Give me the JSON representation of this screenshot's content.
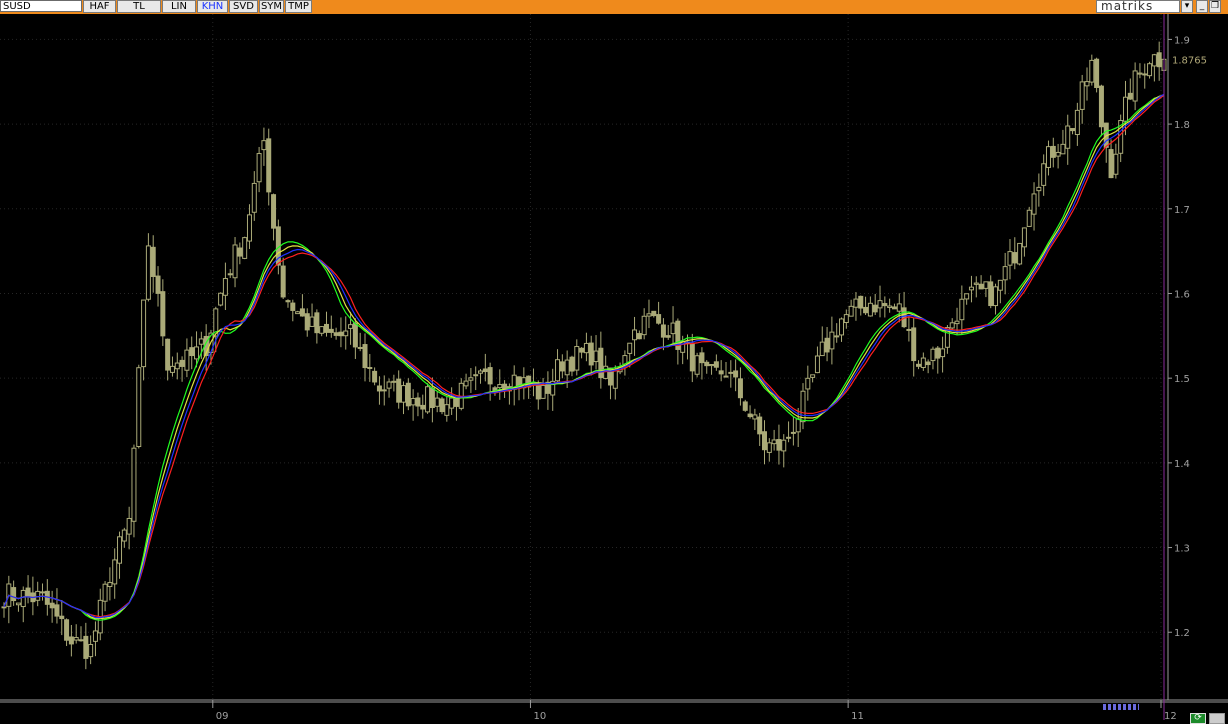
{
  "toolbar": {
    "symbol": "SUSD",
    "buttons": [
      "HAF",
      "TL",
      "LIN",
      "KHN",
      "SVD",
      "SYM",
      "TMP"
    ],
    "active_button": "KHN",
    "brand": "matriks",
    "dropdown_icon": "chevron-down-icon",
    "window_buttons": [
      "minimize-icon",
      "restore-icon"
    ]
  },
  "colors": {
    "background": "#000000",
    "toolbar": "#ef8a1c",
    "candle": "#aaaa78",
    "axis_text": "#a0a0a0",
    "last_price": "#b0a878",
    "ma_blue": "#2030ff",
    "ma_red": "#ff2020",
    "ma_green": "#20ff20",
    "ma_yellow": "#e0e040",
    "cursor_line": "#8a2a9a"
  },
  "chart_data": {
    "type": "candlestick",
    "ylim": [
      1.12,
      1.93
    ],
    "y_ticks": [
      "1.2",
      "1.3",
      "1.4",
      "1.5",
      "1.6",
      "1.7",
      "1.8",
      "1.9"
    ],
    "last_price": "1.8765",
    "x_ticks": [
      {
        "label": "09",
        "index": 44
      },
      {
        "label": "10",
        "index": 110
      },
      {
        "label": "11",
        "index": 176
      },
      {
        "label": "12",
        "index": 241
      }
    ],
    "candle_count": 242,
    "anchors": [
      [
        0,
        1.245
      ],
      [
        8,
        1.24
      ],
      [
        14,
        1.19
      ],
      [
        18,
        1.18
      ],
      [
        22,
        1.27
      ],
      [
        26,
        1.33
      ],
      [
        28,
        1.5
      ],
      [
        30,
        1.66
      ],
      [
        34,
        1.52
      ],
      [
        38,
        1.52
      ],
      [
        42,
        1.54
      ],
      [
        46,
        1.62
      ],
      [
        50,
        1.67
      ],
      [
        54,
        1.78
      ],
      [
        56,
        1.68
      ],
      [
        58,
        1.6
      ],
      [
        62,
        1.57
      ],
      [
        66,
        1.55
      ],
      [
        72,
        1.55
      ],
      [
        78,
        1.49
      ],
      [
        84,
        1.48
      ],
      [
        92,
        1.47
      ],
      [
        100,
        1.5
      ],
      [
        106,
        1.5
      ],
      [
        112,
        1.48
      ],
      [
        116,
        1.52
      ],
      [
        122,
        1.53
      ],
      [
        126,
        1.49
      ],
      [
        130,
        1.55
      ],
      [
        134,
        1.57
      ],
      [
        138,
        1.56
      ],
      [
        142,
        1.53
      ],
      [
        146,
        1.5
      ],
      [
        150,
        1.51
      ],
      [
        154,
        1.47
      ],
      [
        158,
        1.42
      ],
      [
        162,
        1.42
      ],
      [
        166,
        1.47
      ],
      [
        170,
        1.53
      ],
      [
        174,
        1.57
      ],
      [
        180,
        1.59
      ],
      [
        186,
        1.58
      ],
      [
        190,
        1.52
      ],
      [
        194,
        1.53
      ],
      [
        198,
        1.58
      ],
      [
        202,
        1.6
      ],
      [
        206,
        1.6
      ],
      [
        210,
        1.65
      ],
      [
        214,
        1.73
      ],
      [
        218,
        1.77
      ],
      [
        222,
        1.8
      ],
      [
        226,
        1.87
      ],
      [
        228,
        1.8
      ],
      [
        230,
        1.75
      ],
      [
        234,
        1.84
      ],
      [
        238,
        1.88
      ],
      [
        241,
        1.8765
      ]
    ],
    "ma_series": [
      {
        "color": "ma_green",
        "period": 16
      },
      {
        "color": "ma_yellow",
        "period": 17
      },
      {
        "color": "ma_red",
        "period": 19
      },
      {
        "color": "ma_blue",
        "period": 18
      }
    ]
  }
}
